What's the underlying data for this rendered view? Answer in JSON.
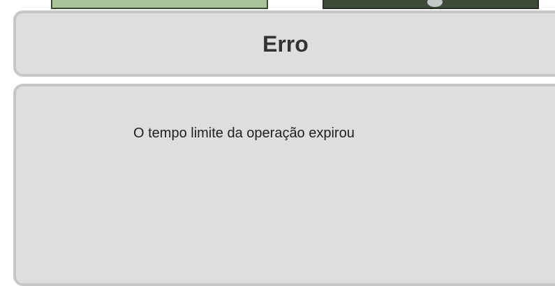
{
  "dialog": {
    "title": "Erro",
    "message": "O tempo limite da operação expirou"
  },
  "colors": {
    "panel_background": "#dedede",
    "panel_border": "#c6c6c6",
    "title_text": "#333333",
    "message_text": "#1f1f1f"
  }
}
